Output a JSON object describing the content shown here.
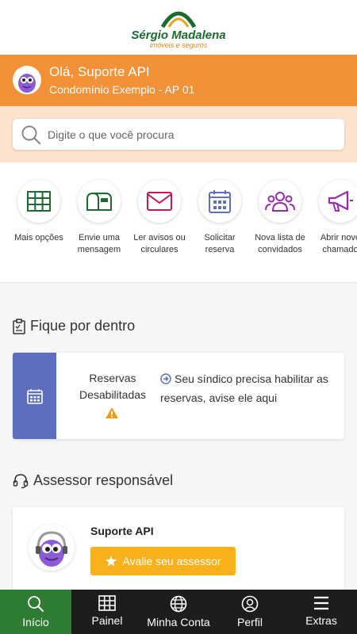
{
  "brand": {
    "name": "Sérgio Madalena",
    "tagline": "imóveis e seguros"
  },
  "user": {
    "greeting": "Olá, Suporte API",
    "condo": "Condomínio Exemplo - AP 01"
  },
  "search": {
    "placeholder": "Digite o que você procura"
  },
  "shortcuts": [
    {
      "label": "Mais opções",
      "icon": "grid-icon",
      "color": "#1a6b2e"
    },
    {
      "label": "Envie uma mensagem",
      "icon": "mailbox-icon",
      "color": "#1a6b2e"
    },
    {
      "label": "Ler avisos ou circulares",
      "icon": "envelope-icon",
      "color": "#c2185b"
    },
    {
      "label": "Solicitar reserva",
      "icon": "calendar-icon",
      "color": "#5f6fbf"
    },
    {
      "label": "Nova lista de convidados",
      "icon": "group-icon",
      "color": "#9c27b0"
    },
    {
      "label": "Abrir novo chamado",
      "icon": "megaphone-icon",
      "color": "#9c27b0"
    }
  ],
  "news": {
    "title": "Fique por dentro",
    "reserva_status": "Reservas Desabilitadas",
    "reserva_message": "Seu síndico precisa habilitar as reservas, avise ele aqui"
  },
  "assessor": {
    "title": "Assessor responsável",
    "name": "Suporte API",
    "rate_label": "Avalie seu assessor"
  },
  "nav": [
    {
      "label": "Início",
      "icon": "search-icon",
      "active": true
    },
    {
      "label": "Painel",
      "icon": "grid-icon",
      "active": false
    },
    {
      "label": "Minha Conta",
      "icon": "globe-icon",
      "active": false
    },
    {
      "label": "Perfil",
      "icon": "user-icon",
      "active": false
    },
    {
      "label": "Extras",
      "icon": "menu-icon",
      "active": false
    }
  ],
  "colors": {
    "orange": "#f39138",
    "search_bg": "#fbe3cd",
    "green": "#2e7d32",
    "indigo": "#5f6fbf",
    "yellow": "#f9b11b",
    "nav_bg": "#1d1d1d"
  }
}
